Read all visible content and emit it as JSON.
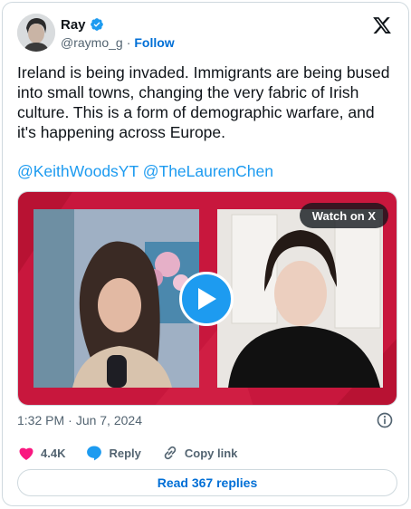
{
  "author": {
    "name": "Ray",
    "handle": "@raymo_g",
    "separator": "·",
    "follow_label": "Follow"
  },
  "post": {
    "text": "Ireland is being invaded. Immigrants are being bused into small towns, changing the very fabric of Irish culture. This is a form of demographic warfare, and it's happening across Europe.",
    "mentions": [
      "@KeithWoodsYT",
      "@TheLaurenChen"
    ],
    "time": "1:32 PM",
    "date_separator": "·",
    "date": "Jun 7, 2024"
  },
  "media": {
    "watch_label": "Watch on X",
    "frame_color": "#c8173d",
    "play_color": "#1d9bf0"
  },
  "actions": {
    "likes": "4.4K",
    "reply_label": "Reply",
    "copy_label": "Copy link"
  },
  "read_replies_label": "Read 367 replies",
  "colors": {
    "accent": "#1d9bf0",
    "like": "#f91880",
    "link": "#006fd6",
    "muted": "#536471"
  },
  "icons": [
    "verified-badge-icon",
    "x-logo-icon",
    "play-icon",
    "info-icon",
    "heart-icon",
    "reply-bubble-icon",
    "link-icon"
  ]
}
